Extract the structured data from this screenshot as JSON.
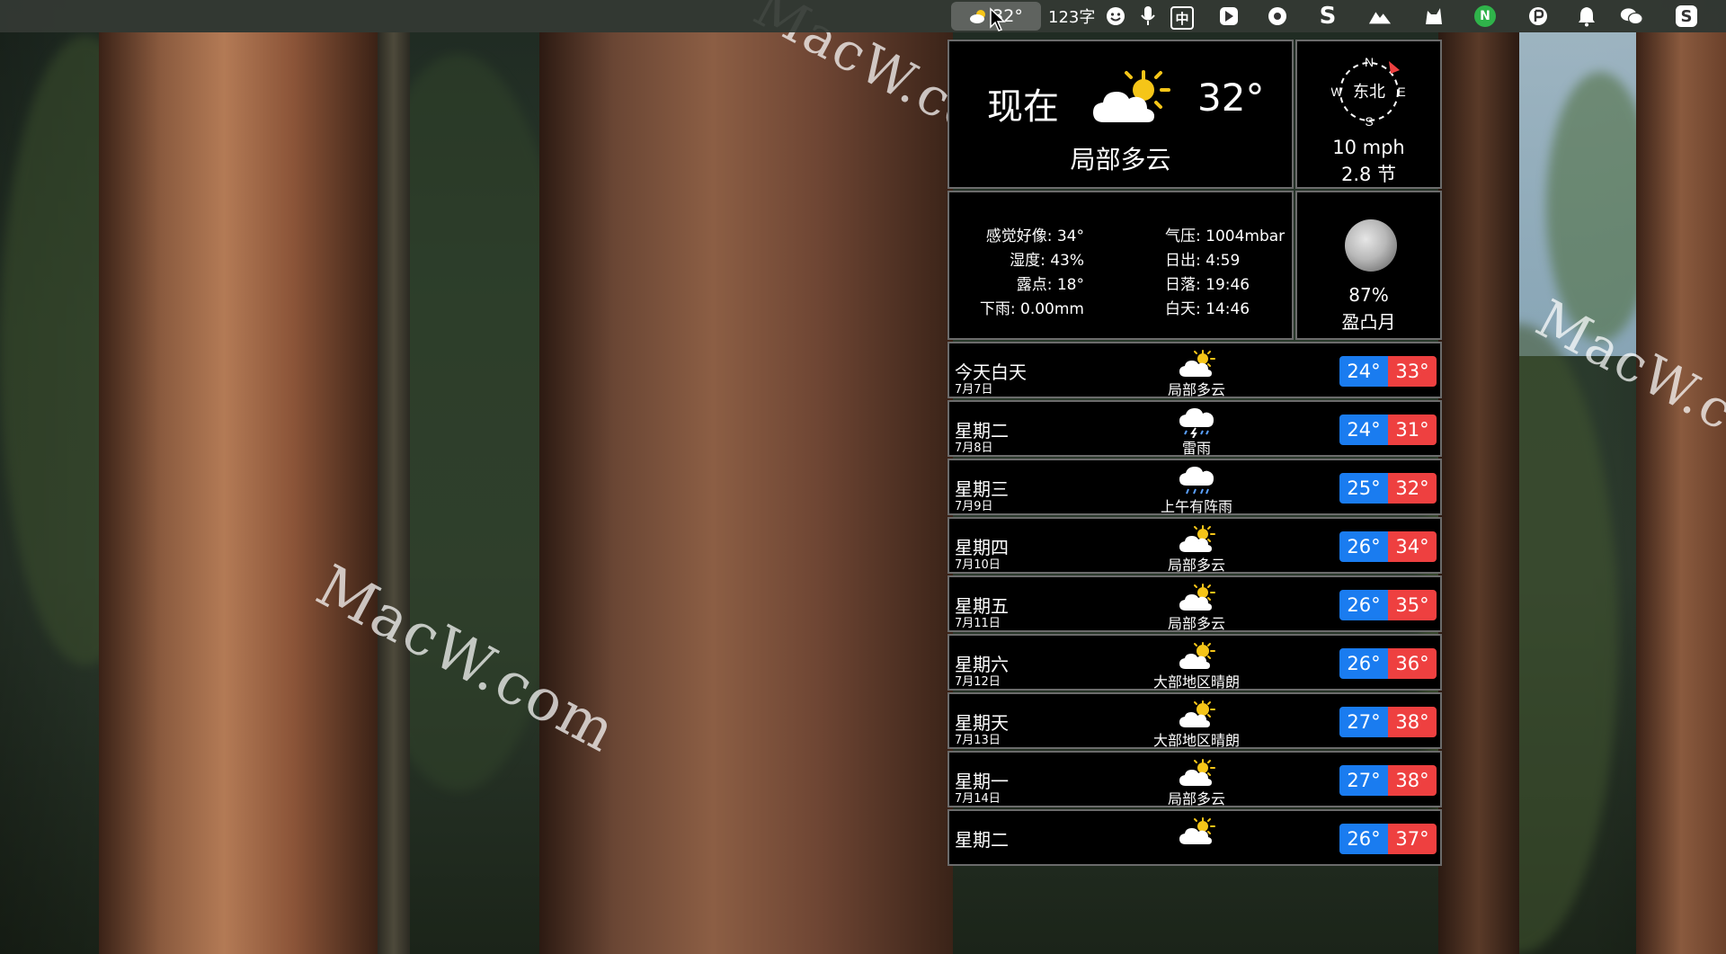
{
  "watermark": "MacW.com",
  "menubar": {
    "weather_temp": "32°",
    "word_count": "123字",
    "input_method": "中"
  },
  "current": {
    "label": "现在",
    "temperature": "32°",
    "condition": "局部多云",
    "icon": "partly-cloudy-icon"
  },
  "wind": {
    "direction": "东北",
    "compass_n": "N",
    "compass_s": "S",
    "compass_e": "E",
    "compass_w": "W",
    "speed": "10 mph",
    "knots": "2.8 节"
  },
  "details": {
    "feels_like": "感觉好像: 34°",
    "humidity": "湿度: 43%",
    "dew_point": "露点: 18°",
    "precipitation": "下雨: 0.00mm",
    "pressure": "气压: 1004mbar",
    "sunrise": "日出: 4:59",
    "sunset": "日落: 19:46",
    "daylight": "白天: 14:46"
  },
  "moon": {
    "illumination": "87%",
    "phase": "盈凸月"
  },
  "forecast": [
    {
      "day": "今天白天",
      "date": "7月7日",
      "condition": "局部多云",
      "icon": "partly-cloudy-icon",
      "low": "24°",
      "high": "33°"
    },
    {
      "day": "星期二",
      "date": "7月8日",
      "condition": "雷雨",
      "icon": "thunderstorm-icon",
      "low": "24°",
      "high": "31°"
    },
    {
      "day": "星期三",
      "date": "7月9日",
      "condition": "上午有阵雨",
      "icon": "rain-icon",
      "low": "25°",
      "high": "32°"
    },
    {
      "day": "星期四",
      "date": "7月10日",
      "condition": "局部多云",
      "icon": "partly-cloudy-icon",
      "low": "26°",
      "high": "34°"
    },
    {
      "day": "星期五",
      "date": "7月11日",
      "condition": "局部多云",
      "icon": "partly-cloudy-icon",
      "low": "26°",
      "high": "35°"
    },
    {
      "day": "星期六",
      "date": "7月12日",
      "condition": "大部地区晴朗",
      "icon": "mostly-sunny-icon",
      "low": "26°",
      "high": "36°"
    },
    {
      "day": "星期天",
      "date": "7月13日",
      "condition": "大部地区晴朗",
      "icon": "mostly-sunny-icon",
      "low": "27°",
      "high": "38°"
    },
    {
      "day": "星期一",
      "date": "7月14日",
      "condition": "局部多云",
      "icon": "partly-cloudy-icon",
      "low": "27°",
      "high": "38°"
    },
    {
      "day": "星期二",
      "date": "",
      "condition": "",
      "icon": "partly-cloudy-icon",
      "low": "26°",
      "high": "37°"
    }
  ],
  "colors": {
    "low_temp": "#1a7cf0",
    "high_temp": "#ee4040",
    "sun": "#f5c518"
  }
}
